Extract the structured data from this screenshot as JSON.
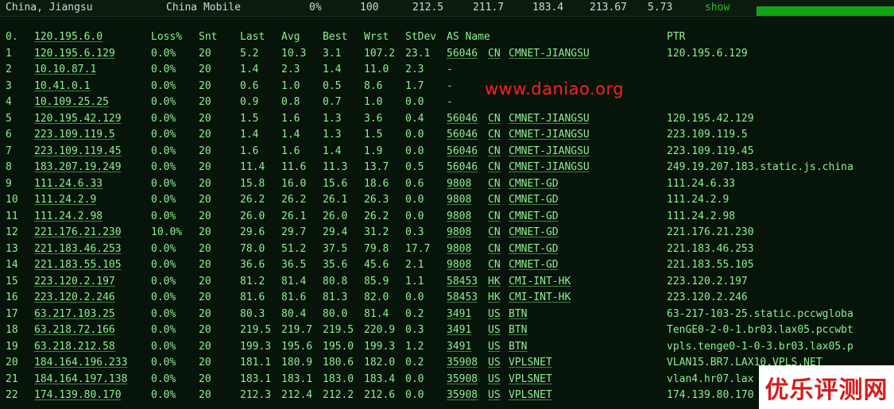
{
  "summary": {
    "location": "China, Jiangsu",
    "isp": "China Mobile",
    "loss": "0%",
    "sent": "100",
    "last": "212.5",
    "avg": "211.7",
    "best": "183.4",
    "worst": "213.67",
    "stdev": "5.73",
    "show_label": "show",
    "progress": 1.0
  },
  "table": {
    "headers": {
      "idx": "0.",
      "ip": "120.195.6.0",
      "loss": "Loss%",
      "snt": "Snt",
      "last": "Last",
      "avg": "Avg",
      "best": "Best",
      "wrst": "Wrst",
      "stdev": "StDev",
      "asname": "AS Name",
      "ptr": "PTR"
    },
    "rows": [
      {
        "idx": "1",
        "ip": "120.195.6.129",
        "loss": "0.0%",
        "snt": "20",
        "last": "5.2",
        "avg": "10.3",
        "best": "3.1",
        "wrst": "107.2",
        "stdev": "23.1",
        "asn": "56046",
        "cc": "CN",
        "asname": "CMNET-JIANGSU",
        "ptr": "120.195.6.129"
      },
      {
        "idx": "2",
        "ip": "10.10.87.1",
        "loss": "0.0%",
        "snt": "20",
        "last": "1.4",
        "avg": "2.3",
        "best": "1.4",
        "wrst": "11.0",
        "stdev": "2.3",
        "asn": "-",
        "cc": "",
        "asname": "",
        "ptr": ""
      },
      {
        "idx": "3",
        "ip": "10.41.0.1",
        "loss": "0.0%",
        "snt": "20",
        "last": "0.6",
        "avg": "1.0",
        "best": "0.5",
        "wrst": "8.6",
        "stdev": "1.7",
        "asn": "-",
        "cc": "",
        "asname": "",
        "ptr": ""
      },
      {
        "idx": "4",
        "ip": "10.109.25.25",
        "loss": "0.0%",
        "snt": "20",
        "last": "0.9",
        "avg": "0.8",
        "best": "0.7",
        "wrst": "1.0",
        "stdev": "0.0",
        "asn": "-",
        "cc": "",
        "asname": "",
        "ptr": ""
      },
      {
        "idx": "5",
        "ip": "120.195.42.129",
        "loss": "0.0%",
        "snt": "20",
        "last": "1.5",
        "avg": "1.6",
        "best": "1.3",
        "wrst": "3.6",
        "stdev": "0.4",
        "asn": "56046",
        "cc": "CN",
        "asname": "CMNET-JIANGSU",
        "ptr": "120.195.42.129"
      },
      {
        "idx": "6",
        "ip": "223.109.119.5",
        "loss": "0.0%",
        "snt": "20",
        "last": "1.4",
        "avg": "1.4",
        "best": "1.3",
        "wrst": "1.5",
        "stdev": "0.0",
        "asn": "56046",
        "cc": "CN",
        "asname": "CMNET-JIANGSU",
        "ptr": "223.109.119.5"
      },
      {
        "idx": "7",
        "ip": "223.109.119.45",
        "loss": "0.0%",
        "snt": "20",
        "last": "1.6",
        "avg": "1.6",
        "best": "1.4",
        "wrst": "1.9",
        "stdev": "0.0",
        "asn": "56046",
        "cc": "CN",
        "asname": "CMNET-JIANGSU",
        "ptr": "223.109.119.45"
      },
      {
        "idx": "8",
        "ip": "183.207.19.249",
        "loss": "0.0%",
        "snt": "20",
        "last": "11.4",
        "avg": "11.6",
        "best": "11.3",
        "wrst": "13.7",
        "stdev": "0.5",
        "asn": "56046",
        "cc": "CN",
        "asname": "CMNET-JIANGSU",
        "ptr": "249.19.207.183.static.js.china"
      },
      {
        "idx": "9",
        "ip": "111.24.6.33",
        "loss": "0.0%",
        "snt": "20",
        "last": "15.8",
        "avg": "16.0",
        "best": "15.6",
        "wrst": "18.6",
        "stdev": "0.6",
        "asn": "9808",
        "cc": "CN",
        "asname": "CMNET-GD",
        "ptr": "111.24.6.33"
      },
      {
        "idx": "10",
        "ip": "111.24.2.9",
        "loss": "0.0%",
        "snt": "20",
        "last": "26.2",
        "avg": "26.2",
        "best": "26.1",
        "wrst": "26.3",
        "stdev": "0.0",
        "asn": "9808",
        "cc": "CN",
        "asname": "CMNET-GD",
        "ptr": "111.24.2.9"
      },
      {
        "idx": "11",
        "ip": "111.24.2.98",
        "loss": "0.0%",
        "snt": "20",
        "last": "26.0",
        "avg": "26.1",
        "best": "26.0",
        "wrst": "26.2",
        "stdev": "0.0",
        "asn": "9808",
        "cc": "CN",
        "asname": "CMNET-GD",
        "ptr": "111.24.2.98"
      },
      {
        "idx": "12",
        "ip": "221.176.21.230",
        "loss": "10.0%",
        "snt": "20",
        "last": "29.6",
        "avg": "29.7",
        "best": "29.4",
        "wrst": "31.2",
        "stdev": "0.3",
        "asn": "9808",
        "cc": "CN",
        "asname": "CMNET-GD",
        "ptr": "221.176.21.230"
      },
      {
        "idx": "13",
        "ip": "221.183.46.253",
        "loss": "0.0%",
        "snt": "20",
        "last": "78.0",
        "avg": "51.2",
        "best": "37.5",
        "wrst": "79.8",
        "stdev": "17.7",
        "asn": "9808",
        "cc": "CN",
        "asname": "CMNET-GD",
        "ptr": "221.183.46.253"
      },
      {
        "idx": "14",
        "ip": "221.183.55.105",
        "loss": "0.0%",
        "snt": "20",
        "last": "36.6",
        "avg": "36.5",
        "best": "35.6",
        "wrst": "45.6",
        "stdev": "2.1",
        "asn": "9808",
        "cc": "CN",
        "asname": "CMNET-GD",
        "ptr": "221.183.55.105"
      },
      {
        "idx": "15",
        "ip": "223.120.2.197",
        "loss": "0.0%",
        "snt": "20",
        "last": "81.2",
        "avg": "81.4",
        "best": "80.8",
        "wrst": "85.9",
        "stdev": "1.1",
        "asn": "58453",
        "cc": "HK",
        "asname": "CMI-INT-HK",
        "ptr": "223.120.2.197"
      },
      {
        "idx": "16",
        "ip": "223.120.2.246",
        "loss": "0.0%",
        "snt": "20",
        "last": "81.6",
        "avg": "81.6",
        "best": "81.3",
        "wrst": "82.0",
        "stdev": "0.0",
        "asn": "58453",
        "cc": "HK",
        "asname": "CMI-INT-HK",
        "ptr": "223.120.2.246"
      },
      {
        "idx": "17",
        "ip": "63.217.103.25",
        "loss": "0.0%",
        "snt": "20",
        "last": "80.3",
        "avg": "80.4",
        "best": "80.0",
        "wrst": "81.4",
        "stdev": "0.2",
        "asn": "3491",
        "cc": "US",
        "asname": "BTN",
        "ptr": "63-217-103-25.static.pccwgloba"
      },
      {
        "idx": "18",
        "ip": "63.218.72.166",
        "loss": "0.0%",
        "snt": "20",
        "last": "219.5",
        "avg": "219.7",
        "best": "219.5",
        "wrst": "220.9",
        "stdev": "0.3",
        "asn": "3491",
        "cc": "US",
        "asname": "BTN",
        "ptr": "TenGE0-2-0-1.br03.lax05.pccwbt"
      },
      {
        "idx": "19",
        "ip": "63.218.212.58",
        "loss": "0.0%",
        "snt": "20",
        "last": "199.3",
        "avg": "195.6",
        "best": "195.0",
        "wrst": "199.3",
        "stdev": "1.2",
        "asn": "3491",
        "cc": "US",
        "asname": "BTN",
        "ptr": "vpls.tenge0-1-0-3.br03.lax05.p"
      },
      {
        "idx": "20",
        "ip": "184.164.196.233",
        "loss": "0.0%",
        "snt": "20",
        "last": "181.1",
        "avg": "180.9",
        "best": "180.6",
        "wrst": "182.0",
        "stdev": "0.2",
        "asn": "35908",
        "cc": "US",
        "asname": "VPLSNET",
        "ptr": "VLAN15.BR7.LAX10.VPLS.NET"
      },
      {
        "idx": "21",
        "ip": "184.164.197.138",
        "loss": "0.0%",
        "snt": "20",
        "last": "183.1",
        "avg": "183.1",
        "best": "183.0",
        "wrst": "183.4",
        "stdev": "0.0",
        "asn": "35908",
        "cc": "US",
        "asname": "VPLSNET",
        "ptr": "vlan4.hr07.lax"
      },
      {
        "idx": "22",
        "ip": "174.139.80.170",
        "loss": "0.0%",
        "snt": "20",
        "last": "212.3",
        "avg": "212.4",
        "best": "212.2",
        "wrst": "212.6",
        "stdev": "0.0",
        "asn": "35908",
        "cc": "US",
        "asname": "VPLSNET",
        "ptr": "174.139.80.170"
      }
    ]
  },
  "watermark": "www.daniao.org",
  "badge": "优乐评测网",
  "colors": {
    "background": "#06140a",
    "text": "#8ef08e",
    "progress": "#15a315",
    "watermark": "#ff2020",
    "badge_text": "#d81b1b"
  }
}
